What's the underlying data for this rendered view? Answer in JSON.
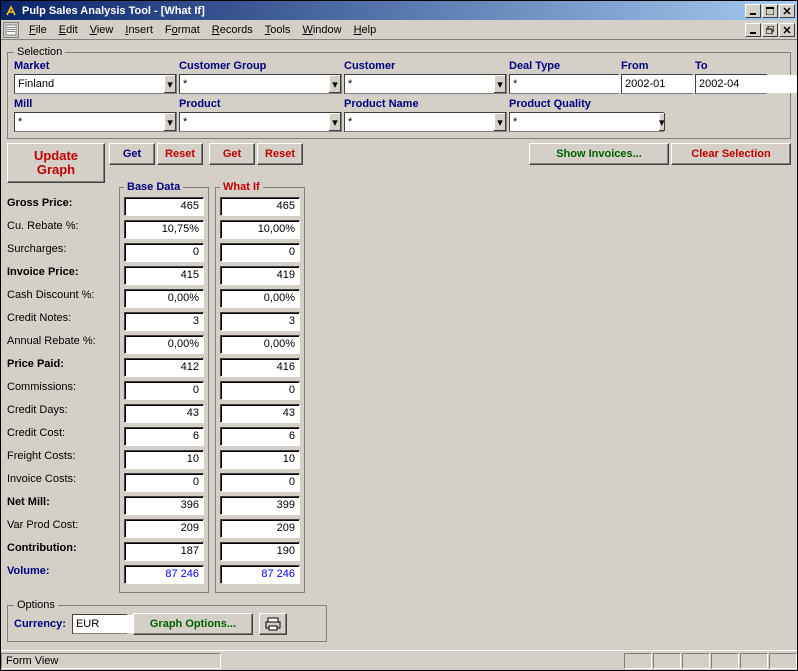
{
  "title": "Pulp Sales Analysis Tool - [What If]",
  "menus": [
    "File",
    "Edit",
    "View",
    "Insert",
    "Format",
    "Records",
    "Tools",
    "Window",
    "Help"
  ],
  "selection": {
    "legend": "Selection",
    "labels": {
      "market": "Market",
      "customer_group": "Customer Group",
      "customer": "Customer",
      "deal_type": "Deal Type",
      "from": "From",
      "to": "To",
      "mill": "Mill",
      "product": "Product",
      "product_name": "Product Name",
      "product_quality": "Product Quality"
    },
    "values": {
      "market": "Finland",
      "customer_group": "*",
      "customer": "*",
      "deal_type": "*",
      "from": "2002-01",
      "to": "2002-04",
      "mill": "*",
      "product": "*",
      "product_name": "*",
      "product_quality": "*"
    }
  },
  "buttons": {
    "update_l1": "Update",
    "update_l2": "Graph",
    "get": "Get",
    "reset": "Reset",
    "show_invoices": "Show Invoices...",
    "clear_selection": "Clear Selection",
    "graph_options": "Graph Options..."
  },
  "columns": {
    "base": "Base Data",
    "whatif": "What If"
  },
  "rows": [
    {
      "label": "Gross Price:",
      "bold": true
    },
    {
      "label": "Cu. Rebate %:"
    },
    {
      "label": "Surcharges:"
    },
    {
      "label": "Invoice Price:",
      "bold": true
    },
    {
      "label": "Cash Discount %:"
    },
    {
      "label": "Credit Notes:"
    },
    {
      "label": "Annual Rebate %:"
    },
    {
      "label": "Price Paid:",
      "bold": true
    },
    {
      "label": "Commissions:"
    },
    {
      "label": "Credit Days:"
    },
    {
      "label": "Credit Cost:"
    },
    {
      "label": "Freight Costs:"
    },
    {
      "label": "Invoice Costs:"
    },
    {
      "label": "Net Mill:",
      "bold": true
    },
    {
      "label": "Var Prod Cost:"
    },
    {
      "label": "Contribution:",
      "bold": true
    },
    {
      "label": "Volume:",
      "blue": true
    }
  ],
  "base": [
    "465",
    "10,75%",
    "0",
    "415",
    "0,00%",
    "3",
    "0,00%",
    "412",
    "0",
    "43",
    "6",
    "10",
    "0",
    "396",
    "209",
    "187",
    "87 246"
  ],
  "whatif": [
    "465",
    "10,00%",
    "0",
    "419",
    "0,00%",
    "3",
    "0,00%",
    "416",
    "0",
    "43",
    "6",
    "10",
    "0",
    "399",
    "209",
    "190",
    "87 246"
  ],
  "options": {
    "legend": "Options",
    "currency_label": "Currency:",
    "currency": "EUR"
  },
  "status": "Form View"
}
